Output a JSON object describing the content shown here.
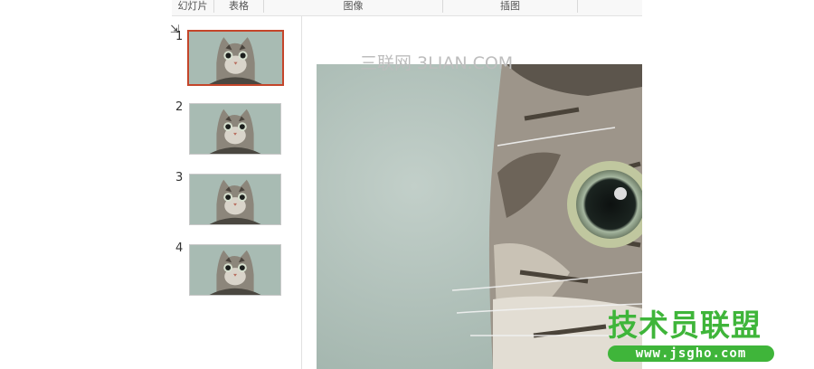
{
  "ribbon": {
    "groups": [
      {
        "label": "幻灯片"
      },
      {
        "label": "表格"
      },
      {
        "label": "图像"
      },
      {
        "label": "插图"
      }
    ]
  },
  "slides": [
    {
      "number": "1",
      "selected": true
    },
    {
      "number": "2",
      "selected": false
    },
    {
      "number": "3",
      "selected": false
    },
    {
      "number": "4",
      "selected": false
    }
  ],
  "watermark": {
    "text": "三联网 3LIAN.COM"
  },
  "logo": {
    "title": "技术员联盟",
    "url": "www.jsgho.com"
  },
  "colors": {
    "selection_border": "#c4452a",
    "logo_green": "#3fb53a",
    "slide_background": "#b4c3bd"
  }
}
